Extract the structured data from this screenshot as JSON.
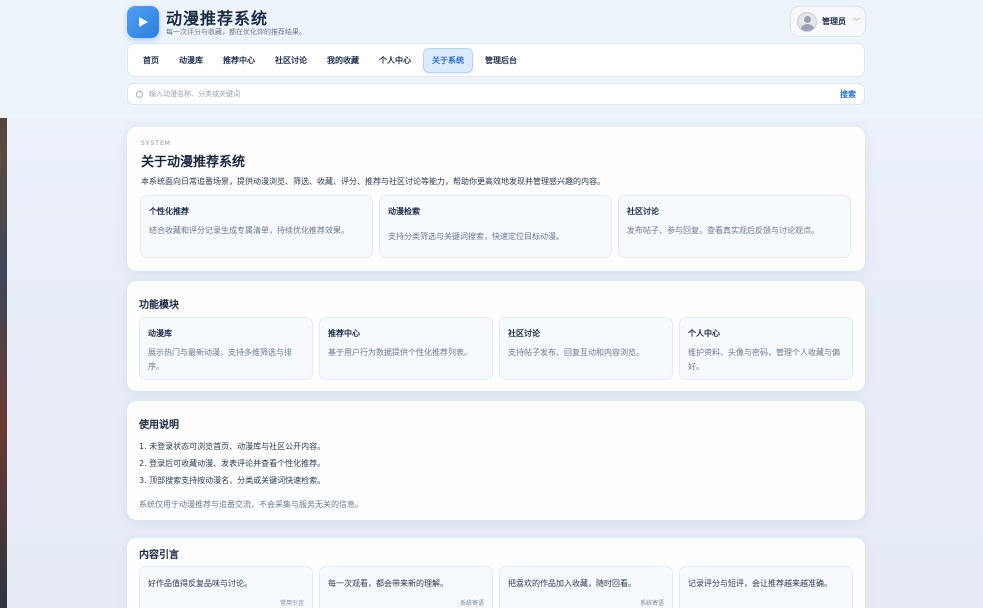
{
  "app": {
    "title": "动漫推荐系统",
    "subtitle": "每一次评分与收藏，都在优化你的推荐结果。",
    "user": "管理员"
  },
  "nav": {
    "items": [
      "首页",
      "动漫库",
      "推荐中心",
      "社区讨论",
      "我的收藏",
      "个人中心",
      "关于系统",
      "管理后台"
    ],
    "active": "关于系统"
  },
  "search": {
    "placeholder": "输入动漫名称、分类或关键词",
    "button": "搜索"
  },
  "about": {
    "eyebrow": "SYSTEM",
    "title": "关于动漫推荐系统",
    "desc": "本系统面向日常追番场景，提供动漫浏览、筛选、收藏、评分、推荐与社区讨论等能力，帮助你更高效地发现并管理感兴趣的内容。",
    "features": [
      {
        "title": "个性化推荐",
        "text": "结合收藏和评分记录生成专属清单，持续优化推荐效果。"
      },
      {
        "title": "动漫检索",
        "text": "支持分类筛选与关键词搜索，快速定位目标动漫。"
      },
      {
        "title": "社区讨论",
        "text": "发布帖子、参与回复，查看真实观后反馈与讨论观点。"
      }
    ]
  },
  "modules": {
    "title": "功能模块",
    "items": [
      {
        "title": "动漫库",
        "text": "展示热门与最新动漫，支持多维筛选与排序。"
      },
      {
        "title": "推荐中心",
        "text": "基于用户行为数据提供个性化推荐列表。"
      },
      {
        "title": "社区讨论",
        "text": "支持帖子发布、回复互动和内容浏览。"
      },
      {
        "title": "个人中心",
        "text": "维护资料、头像与密码，管理个人收藏与偏好。"
      }
    ]
  },
  "usage": {
    "title": "使用说明",
    "lines": [
      "1. 未登录状态可浏览首页、动漫库与社区公开内容。",
      "2. 登录后可收藏动漫、发表评论并查看个性化推荐。",
      "3. 顶部搜索支持按动漫名、分类或关键词快速检索。"
    ],
    "note": "系统仅用于动漫推荐与追番交流，不会采集与服务无关的信息。"
  },
  "quotes": {
    "title": "内容引言",
    "items": [
      {
        "text": "好作品值得反复品味与讨论。",
        "source": "常用引言"
      },
      {
        "text": "每一次观看，都会带来新的理解。",
        "source": "系统寄语"
      },
      {
        "text": "把喜欢的作品加入收藏，随时回看。",
        "source": "系统寄语"
      },
      {
        "text": "记录评分与短评，会让推荐越来越准确。",
        "source": ""
      }
    ]
  }
}
